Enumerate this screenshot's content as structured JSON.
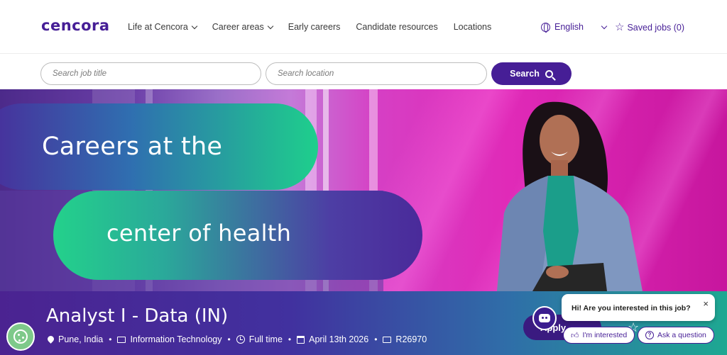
{
  "header": {
    "logo": "cencora",
    "nav": [
      {
        "label": "Life at Cencora",
        "has_dropdown": true
      },
      {
        "label": "Career areas",
        "has_dropdown": true
      },
      {
        "label": "Early careers",
        "has_dropdown": false
      },
      {
        "label": "Candidate resources",
        "has_dropdown": false
      },
      {
        "label": "Locations",
        "has_dropdown": false
      }
    ],
    "language": "English",
    "saved_jobs": "Saved jobs (0)"
  },
  "search": {
    "title_placeholder": "Search job title",
    "location_placeholder": "Search location",
    "button_label": "Search"
  },
  "hero": {
    "line1": "Careers at the",
    "line2": "center of health"
  },
  "job": {
    "title": "Analyst I - Data (IN)",
    "location": "Pune, India",
    "category": "Information Technology",
    "type": "Full time",
    "date": "April 13th 2026",
    "req_id": "R26970",
    "apply_label": "Apply"
  },
  "chatbot": {
    "message": "Hi! Are you interested in this job?",
    "close": "×",
    "option_interested": "I'm interested",
    "option_question": "Ask a question"
  },
  "colors": {
    "brand_purple": "#461e96",
    "brand_green": "#1ecf8c",
    "hero_magenta": "#e02ab8"
  }
}
